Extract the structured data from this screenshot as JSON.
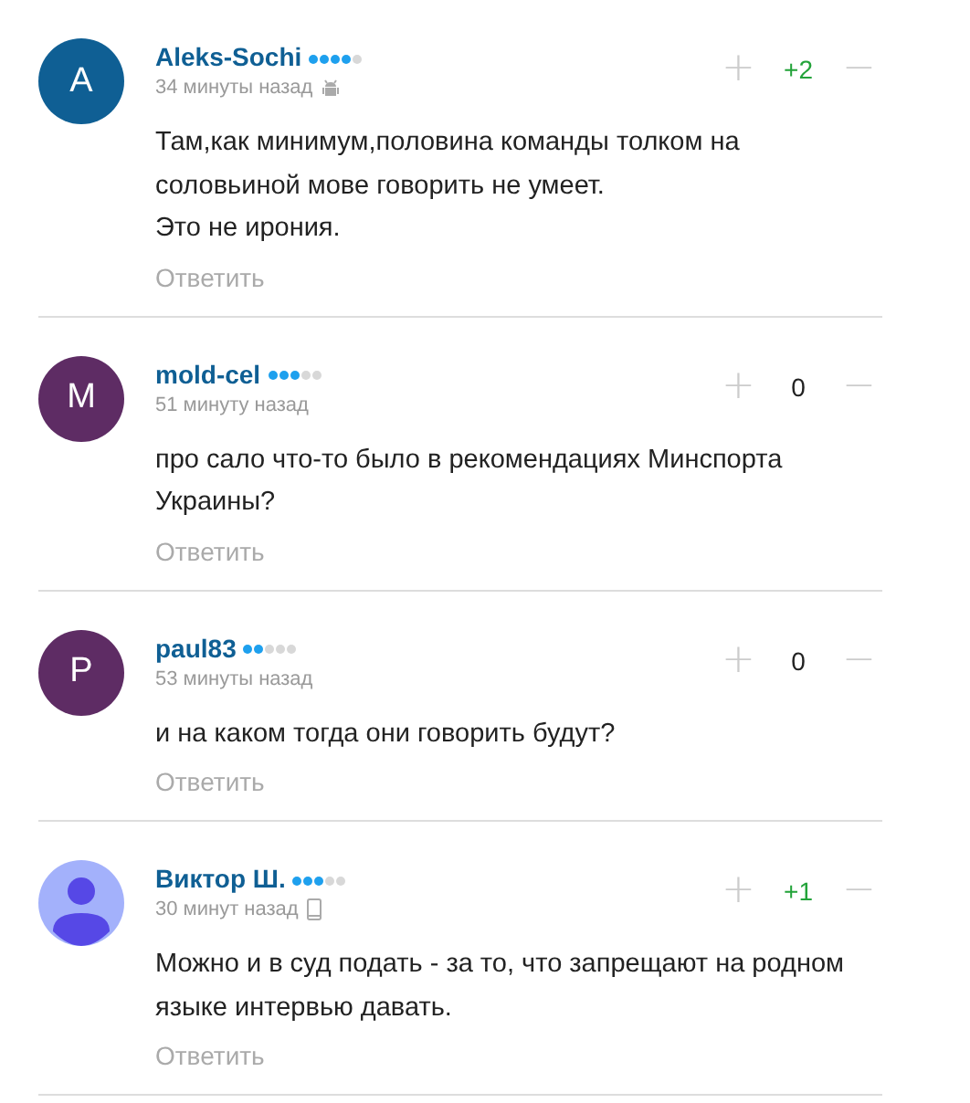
{
  "comments": [
    {
      "author": "Aleks-Sochi",
      "avatar": {
        "kind": "letter",
        "letter": "A",
        "color": "#0f5f94"
      },
      "stars": 4,
      "time": "34 минуты назад",
      "device": {
        "kind": "android"
      },
      "score": {
        "text": "+2",
        "color": "#23a33a"
      },
      "plus": "+",
      "minus": "−",
      "body": "Там,как минимум,половина команды толком на соловьиной мове говорить не умеет.\nЭто не ирония.",
      "reply": "Ответить"
    },
    {
      "author": "mold-cel",
      "avatar": {
        "kind": "letter",
        "letter": "M",
        "color": "#5e2c64"
      },
      "stars": 3,
      "time": "51 минуту назад",
      "score": {
        "text": "0",
        "color": "#222222"
      },
      "plus": "+",
      "minus": "−",
      "body": "про сало что-то было в рекомендациях Минспорта Украины?",
      "reply": "Ответить"
    },
    {
      "author": "paul83",
      "avatar": {
        "kind": "letter",
        "letter": "P",
        "color": "#5e2c64"
      },
      "stars": 2,
      "time": "53 минуты назад",
      "score": {
        "text": "0",
        "color": "#222222"
      },
      "plus": "+",
      "minus": "−",
      "body": "и на каком тогда они говорить будут?",
      "reply": "Ответить"
    },
    {
      "author": "Виктор Ш.",
      "avatar": {
        "kind": "silhouette",
        "color": "#a3b1fb"
      },
      "stars": 3,
      "time": "30 минут назад",
      "device": {
        "kind": "phone"
      },
      "score": {
        "text": "+1",
        "color": "#23a33a"
      },
      "plus": "+",
      "minus": "−",
      "body": "Можно и в суд подать - за то, что запрещают на родном языке интервью давать.",
      "reply": "Ответить"
    }
  ]
}
